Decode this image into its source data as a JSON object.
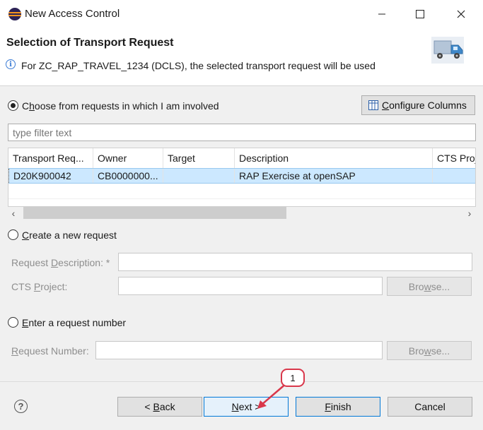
{
  "window": {
    "title": "New Access Control",
    "controls": {
      "minimize": "minimize-icon",
      "maximize": "maximize-icon",
      "close": "close-icon"
    }
  },
  "header": {
    "title": "Selection of Transport Request",
    "message": "For ZC_RAP_TRAVEL_1234 (DCLS), the selected transport request will be used",
    "icon": "transport-truck-icon"
  },
  "choose_section": {
    "radio_prefix": "C",
    "radio_underlined": "h",
    "radio_suffix": "oose from requests in which I am involved",
    "selected": true,
    "configure_prefix": "",
    "configure_underlined": "C",
    "configure_suffix": "onfigure Columns",
    "filter_placeholder": "type filter text"
  },
  "table": {
    "columns": [
      "Transport Req...",
      "Owner",
      "Target",
      "Description",
      "CTS Proje"
    ],
    "rows": [
      {
        "transport": "D20K900042",
        "owner": "CB0000000...",
        "target": "",
        "description": "RAP Exercise at openSAP",
        "cts": "",
        "selected": true
      }
    ],
    "scroll_left": "‹",
    "scroll_right": "›"
  },
  "create_section": {
    "radio_underlined": "C",
    "radio_suffix": "reate a new request",
    "desc_prefix": "Request ",
    "desc_underlined": "D",
    "desc_suffix": "escription: *",
    "desc_value": "",
    "cts_prefix": "CTS ",
    "cts_underlined": "P",
    "cts_suffix": "roject:",
    "cts_value": "",
    "browse_prefix": "Bro",
    "browse_underlined": "w",
    "browse_suffix": "se..."
  },
  "enter_section": {
    "radio_underlined": "E",
    "radio_suffix": "nter a request number",
    "number_underlined": "R",
    "number_suffix": "equest Number:",
    "number_value": "",
    "browse_prefix": "Bro",
    "browse_underlined": "w",
    "browse_suffix": "se..."
  },
  "footer": {
    "help_glyph": "?",
    "back_prefix": "< ",
    "back_underlined": "B",
    "back_suffix": "ack",
    "next_underlined": "N",
    "next_suffix": "ext >",
    "finish_underlined": "F",
    "finish_suffix": "inish",
    "cancel_label": "Cancel"
  },
  "callout": {
    "number": "1",
    "color": "#d9374b"
  }
}
